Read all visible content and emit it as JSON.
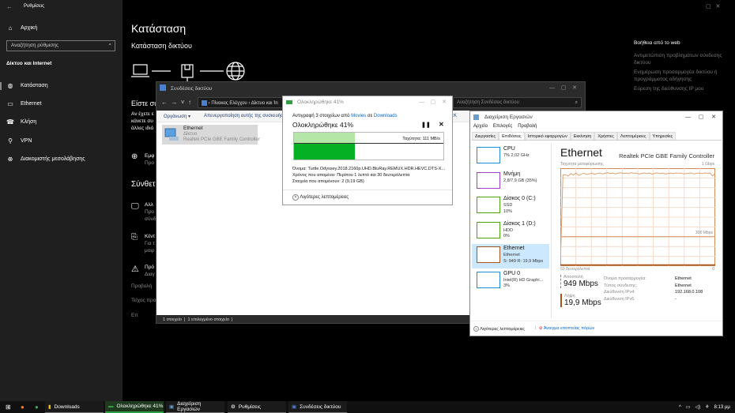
{
  "settings": {
    "title": "Ρυθμίσεις",
    "home": "Αρχική",
    "search_placeholder": "Αναζήτηση ρύθμισης",
    "section": "Δίκτυο και Internet",
    "nav": [
      {
        "label": "Κατάσταση",
        "icon": "globe-status-icon"
      },
      {
        "label": "Ethernet",
        "icon": "ethernet-icon"
      },
      {
        "label": "Κλήση",
        "icon": "dialup-icon"
      },
      {
        "label": "VPN",
        "icon": "vpn-icon"
      },
      {
        "label": "Διακομιστής μεσολάβησης",
        "icon": "globe-icon"
      }
    ],
    "page_title": "Κατάσταση",
    "subtitle": "Κατάσταση δικτύου",
    "connected_fragment": "Είστε συ",
    "para_fragments": [
      "Αν έχετε ε",
      "κάνετε συ",
      "άλλες ιδιό"
    ],
    "show_fragment": [
      "Εμφ",
      "Προ"
    ],
    "advanced_fragment": "Σύνθετ",
    "adv_items": [
      [
        "Αλλ",
        "Προ",
        "σύνδ"
      ],
      [
        "Κέντ",
        "Για τ",
        "μοιρ"
      ],
      [
        "Πρό",
        "Διαγ"
      ]
    ],
    "links_fragments": [
      "Προβολή",
      "Τείχος προ",
      "Επ"
    ],
    "web_help_title": "Βοήθεια από το web",
    "web_help_links": [
      "Αντιμετώπιση προβλημάτων σύνδεσης δικτύου",
      "Ενημέρωση προσαρμογέα δικτύου ή προγράμματος οδήγησης",
      "Εύρεση της διεύθυνσης IP μου"
    ]
  },
  "explorer": {
    "title": "Συνδέσεις δικτύου",
    "breadcrumb": [
      "Πίνακας Ελέγχου",
      "Δίκτυο και Ίn"
    ],
    "search_placeholder": "Αναζήτηση Συνδέσεις δικτύου",
    "organize": "Οργάνωση",
    "disable": "Απενεργοποίηση αυτής της συσκευής",
    "cmd_fragment": "K",
    "item": {
      "name": "Ethernet",
      "type": "Δίκτυο",
      "adapter": "Realtek PCIe GBE Family Controller"
    },
    "status": [
      "1 στοιχείο",
      "1 επιλεγμένο στοιχείο"
    ]
  },
  "copy": {
    "title": "Ολοκληρώθηκε 41%",
    "line_prefix": "Αντιγραφή 3 στοιχείων από",
    "from": "Movies",
    "sep": "σε",
    "to": "Downloads",
    "heading": "Ολοκληρώθηκε 41%",
    "progress": 0.41,
    "speed": "Ταχύτητα: 111 MB/s",
    "name": "Όνομα: Turtle.Odyssey.2018.2160p.UHD.BluRay.REMUX.HDR.HEVC.DTS-X...",
    "time": "Χρόνος που απομένει: Περίπου 1 λεπτό και 30 δευτερόλεπτα",
    "items": "Στοιχεία που απομένουν: 2 (9,19 GB)",
    "less": "Λιγότερες λεπτομέρειες"
  },
  "taskmgr": {
    "title": "Διαχείριση Εργασιών",
    "menu": [
      "Αρχείο",
      "Επιλογές",
      "Προβολή"
    ],
    "tabs": [
      "Διεργασίες",
      "Επιδόσεις",
      "Ιστορικό εφαρμογών",
      "Εκκίνηση",
      "Χρήστες",
      "Λεπτομέρειες",
      "Υπηρεσίες"
    ],
    "active_tab": 1,
    "resources": [
      {
        "name": "CPU",
        "sub1": "7% 2,02 GHz",
        "sub2": "",
        "color": "#1f8dd6"
      },
      {
        "name": "Μνήμη",
        "sub1": "2,8/7,9 GB (35%)",
        "sub2": "",
        "color": "#a43fc7"
      },
      {
        "name": "Δίσκος 0 (C:)",
        "sub1": "SSD",
        "sub2": "10%",
        "color": "#4da60c"
      },
      {
        "name": "Δίσκος 1 (D:)",
        "sub1": "HDD",
        "sub2": "0%",
        "color": "#4da60c"
      },
      {
        "name": "Ethernet",
        "sub1": "Ethernet",
        "sub2": "S: 949 R: 19,9 Mbps",
        "color": "#a7551c"
      },
      {
        "name": "GPU 0",
        "sub1": "Intel(R) HD Graphi...",
        "sub2": "3%",
        "color": "#1f8dd6"
      }
    ],
    "heading": "Ethernet",
    "adapter": "Realtek PCIe GBE Family Controller",
    "graph_label": "Ταχύτητα μεταφόρτωσης",
    "graph_max": "1 Gbps",
    "graph_mid": "300 Mbps",
    "graph_time": "60 δευτερόλεπτα",
    "graph_zero": "0",
    "send_label": "Αποστολή",
    "send": "949 Mbps",
    "recv_label": "Λήψη",
    "recv": "19,9 Mbps",
    "props": [
      [
        "Όνομα προσαρμογέα:",
        "Ethernet"
      ],
      [
        "Τύπος σύνδεσης:",
        "Ethernet"
      ],
      [
        "Διεύθυνση IPv4:",
        "192.168.0.108"
      ],
      [
        "Διεύθυνση IPv6:",
        "-"
      ]
    ],
    "send_series_mbps": [
      0,
      930,
      935,
      920,
      945,
      930,
      950,
      925,
      940,
      948,
      935,
      942,
      950,
      938,
      945,
      952,
      940,
      948,
      955,
      945,
      950,
      942,
      948,
      953,
      946,
      950,
      944,
      955,
      948,
      950,
      940,
      946,
      952,
      945,
      950,
      938,
      948,
      952,
      945,
      950,
      940,
      946,
      950,
      944,
      952,
      948,
      950,
      942,
      946,
      950,
      952,
      940,
      948,
      950,
      945,
      952,
      948,
      950,
      920,
      950
    ],
    "less": "Λιγότερες λεπτομέρειες",
    "resmon": "Άνοιγμα εποπτείας πόρων"
  },
  "taskbar": {
    "items": [
      "Downloads",
      "Ολοκληρώθηκε 41%",
      "Διαχείριση Εργασιών",
      "Ρυθμίσεις",
      "Συνδέσεις δικτύου"
    ],
    "time": "8:13 μμ"
  }
}
